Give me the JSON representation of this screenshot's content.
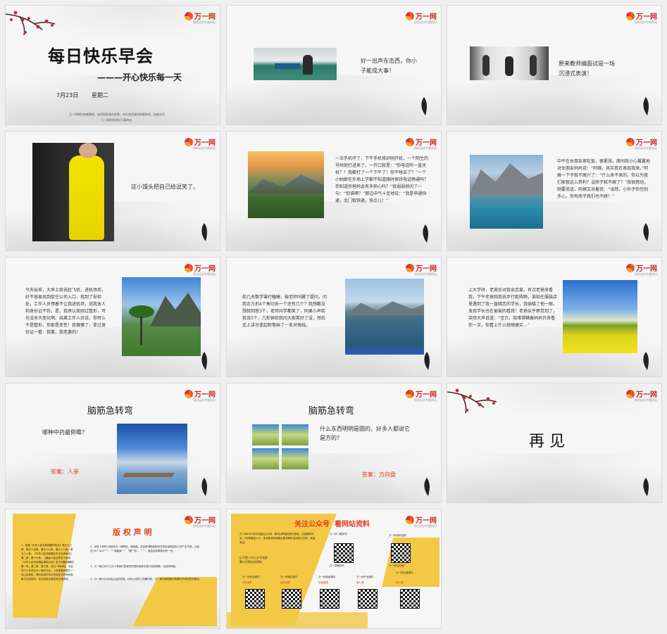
{
  "logo": {
    "name": "万一网",
    "tagline": "保险培训专题网站"
  },
  "slide1": {
    "title": "每日快乐早会",
    "subtitle": "———开心快乐每一天",
    "date": "7月23日",
    "weekday": "星期二",
    "fine1": "万一网制作收集整理，未经授权请勿转载，本社使用请勿转载转发，违者必究",
    "fine2": "万一网保险资料下载网站"
  },
  "slide2": {
    "text": "好一出声东击西，你小子能成大事！"
  },
  "slide3": {
    "text": "原来教师编面试是一场沉浸式表演！"
  },
  "slide4": {
    "text": "这小馒头把自己给逗笑了。"
  },
  "slide5": {
    "text": "一次手机坏了，下午手机修好刚开机，一个陌生的号码就打进来了，一开口就是：“你电话咋一直关机？！我都打了一个下午了！你干啥去了？”一个小姑娘在外地上学都不知道随时保持电话畅通吗？你知道你爸妈会有多担心吗？”我弱弱地问了一句：“你谁啊？”那边中气十足地说：“我是申通快递，北门取快递，快点儿！”"
  },
  "slide6": {
    "text": "中午在女朋友家吃饭，很紧张。席间我小心翼翼地对女朋友妈妈说：“阿姨，其实我在表现我来。”阿姨一下子就不高兴了：“什么来不来的，你以为我们家就这么势利？没房子就不嫁了？”我很感动，刚要说话，阿姨又对着我：“当然，小伙子你也别多心，你有房子我们也不嫁！”"
  },
  "slide7": {
    "text": "今天出差，大早上就去赶飞机，进机场后，好不容易找到航空公司入口，找到了安检处，工作人员愣着不让我进机场，说我本人和身份证不符。是，我承认我刚过整形，可也没多大变化啊。结果工作人员说，你特么不是整形，你那是变性！我懵懵了，拿过身份证一看：我靠，我老婆的！"
  },
  "slide8": {
    "text": "前几天数学课打瞌睡，被老师叫醒了提问，问我正方形4个角切去一个还有几个？我想都没想就回答3个，老师问学都笑了，同桌小声给我说5个，几秒钟后我问大家笑好了没，然后走上讲台拿起粉笔画了一条对角线。"
  },
  "slide9": {
    "text": "上大学时，老爸反对我谈恋爱，有次老爸来看我，下午老爸陪我去步行街购物，谁知在服装店里遇到了我一直暗恋的学长，我偷瞄了他一眼，发现学长也在偷偷的看我！老爸似乎察觉到了，突然大声说道：“宝贝，我难得瞒着妈妈只来看你一次，你看上什么就随便买…”"
  },
  "slide10": {
    "heading": "脑筋急转弯",
    "question": "哪种中药最倒霉？",
    "answer_label": "答案：",
    "answer": "人参"
  },
  "slide11": {
    "heading": "脑筋急转弯",
    "question": "什么东西明明是圆的，好多人都说它是方的？",
    "answer_label": "答案：",
    "answer": "方向盘"
  },
  "slide12": {
    "text": "再 见"
  },
  "slide13": {
    "heading": "版 权 声 明",
    "para1": "1、依据《中华人民共和国著作权法》第五十三条、第五十四条、第五十六条、第五十七条、第五十八条、《中华人民共和国反不正当竞争法》第二条、第十七条、《最高人民法院关于适用《中华人民共和国民事诉讼法》若干问题的解释》第一条、第二条、第三条，对万一网网站、平台的个人在本社为一网作平台，上传或者转载万一网上的资料，同时未经许可以任何形式在所有网络平台发布的，本社将依法追究其法律责任。",
    "para2": "2、对在十年年2月起向万一网网站、电脑端、并且获得网站和官方的电话网站的人员产生不良，已经在“ku”“g19”“”、“”“电脑库”“”、“眼”“站”、“”“”，就会如本条款中的一份。",
    "para3": "3、万一网已对十几万十年我们在我们的资料系统中进行标识授权，包括本网站。",
    "para4": "4、万一网2024年及以后的内容，均为公司员工的著作权，万一网对保险知识的展示不承担任何责任。"
  },
  "slide14": {
    "heading": "关注公众号  看网站资料",
    "intro": "万一网2024年3月推出公众号，即刻分享保险资讯资料，已经精彩好文，6月构建出六个，未来即将持续推出更多精彩活动的公众号，欢迎关注！",
    "line2": "以下是一行公众号名称",
    "line3": "第二行是站点资料",
    "labels": [
      "万一网（服务号）",
      "万一网微信号",
      "万一网资料站群",
      "万一网主页推广",
      "万一网早会课件",
      "万一网增员课件",
      "万一网经营课件",
      "万一网产品课件",
      "万一网主管课件",
      "万一网新闻课件"
    ],
    "captions": [
      "早会课件",
      "保险销售",
      "经营管理",
      "老七课",
      "老七课"
    ]
  }
}
